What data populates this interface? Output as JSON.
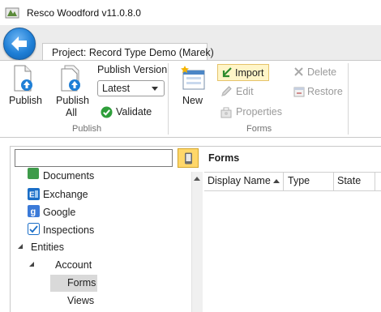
{
  "window": {
    "title": "Resco Woodford v11.0.8.0"
  },
  "tab": {
    "project_label": "Project: Record Type Demo (Marek)"
  },
  "ribbon": {
    "publish": {
      "publish_label": "Publish",
      "publish_all_label_line1": "Publish",
      "publish_all_label_line2": "All",
      "version_label": "Publish Version",
      "version_value": "Latest",
      "validate_label": "Validate",
      "group_label": "Publish"
    },
    "forms": {
      "new_label": "New",
      "import_label": "Import",
      "edit_label": "Edit",
      "properties_label": "Properties",
      "delete_label": "Delete",
      "restore_label": "Restore",
      "group_label": "Forms"
    }
  },
  "tree": {
    "search_value": "",
    "items": [
      {
        "label": "Documents"
      },
      {
        "label": "Exchange"
      },
      {
        "label": "Google"
      },
      {
        "label": "Inspections"
      },
      {
        "label": "Entities"
      },
      {
        "label": "Account"
      },
      {
        "label": "Forms"
      },
      {
        "label": "Views"
      }
    ]
  },
  "main": {
    "title": "Forms",
    "columns": [
      {
        "label": "Display Name"
      },
      {
        "label": "Type"
      },
      {
        "label": "State"
      }
    ]
  },
  "colors": {
    "accent_blue": "#1f7fd6",
    "highlight_yellow": "#ffd76a",
    "selection_gray": "#d9d9d9"
  }
}
